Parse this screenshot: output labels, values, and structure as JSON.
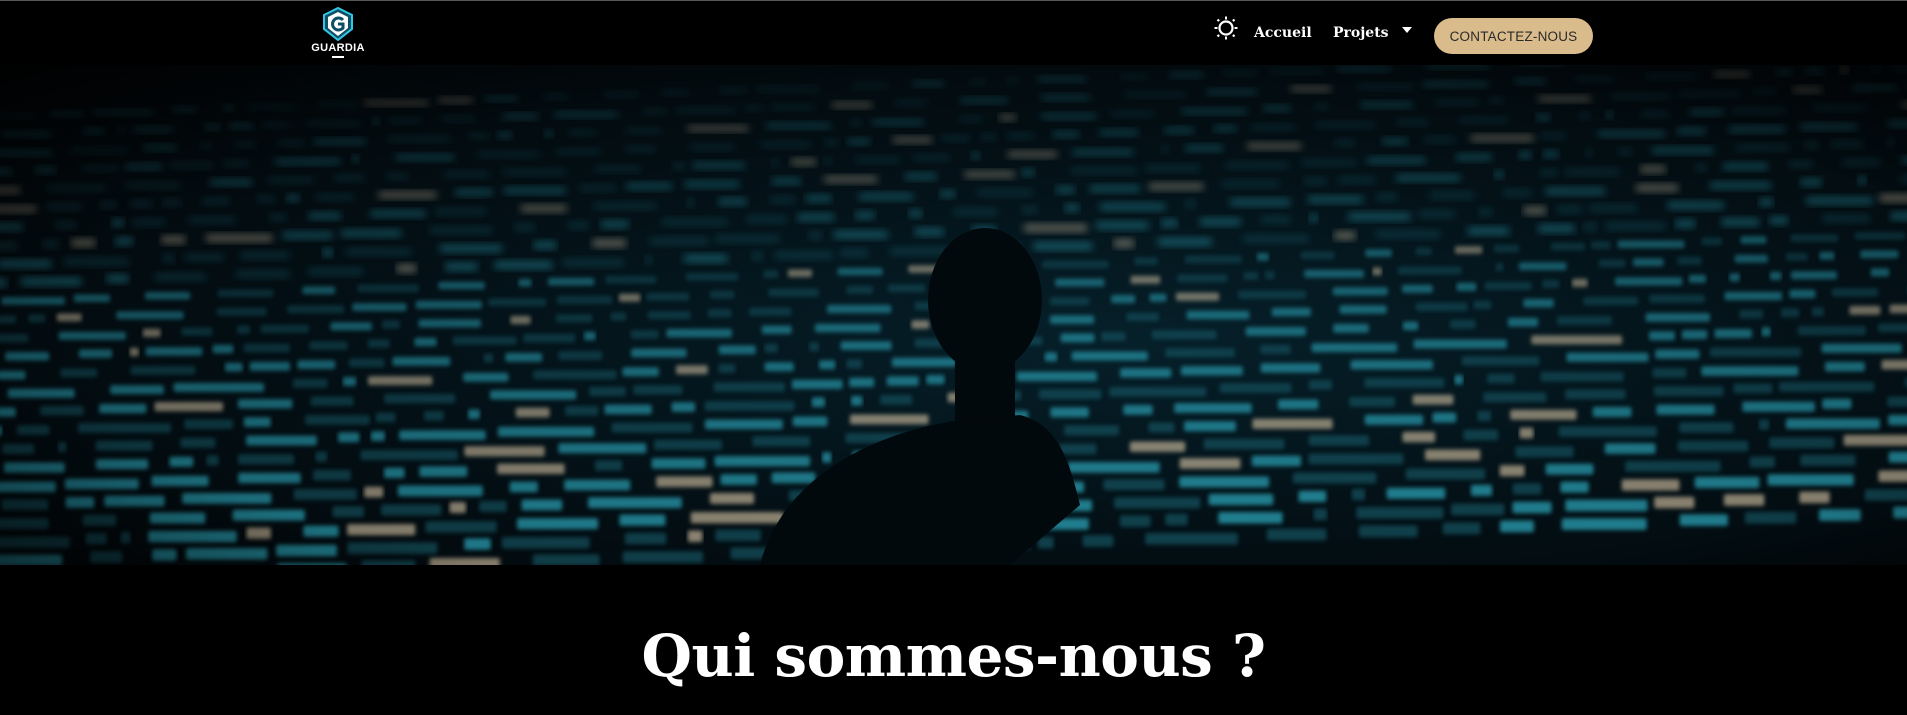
{
  "header": {
    "logo_text": "GUARDIA",
    "logo_icon": "guardia-shield-icon",
    "theme_icon": "sun-icon",
    "nav": {
      "accueil": "Accueil",
      "projets": "Projets",
      "projets_icon": "caret-down-icon"
    },
    "cta_label": "CONTACTEZ-NOUS"
  },
  "hero": {
    "image": "silhouette-in-front-of-code-wall"
  },
  "about": {
    "title": "Qui sommes-nous ?"
  },
  "colors": {
    "cta_background": "#d9bb8c",
    "page_background": "#000000",
    "code_glow": "#2fb3c9"
  }
}
